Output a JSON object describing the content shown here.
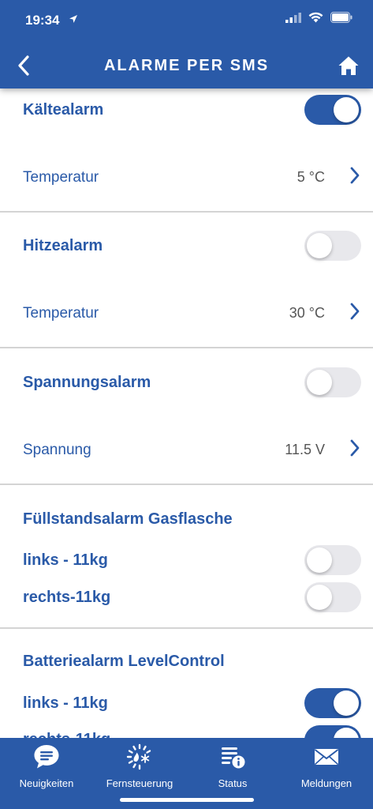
{
  "status": {
    "time": "19:34"
  },
  "header": {
    "title": "ALARME PER SMS"
  },
  "sections": {
    "kaelte": {
      "title": "Kältealarm",
      "toggle_on": true,
      "row_label": "Temperatur",
      "row_value": "5 °C"
    },
    "hitze": {
      "title": "Hitzealarm",
      "toggle_on": false,
      "row_label": "Temperatur",
      "row_value": "30 °C"
    },
    "spannung": {
      "title": "Spannungsalarm",
      "toggle_on": false,
      "row_label": "Spannung",
      "row_value": "11.5 V"
    },
    "fuellstand": {
      "title": "Füllstandsalarm Gasflasche",
      "left_label": "links - 11kg",
      "left_on": false,
      "right_label": "rechts-11kg",
      "right_on": false
    },
    "batterie": {
      "title": "Batteriealarm LevelControl",
      "left_label": "links - 11kg",
      "left_on": true,
      "right_label": "rechts-11kg",
      "right_on": true
    }
  },
  "tabs": [
    {
      "label": "Neuigkeiten",
      "icon": "chat-bubble-icon"
    },
    {
      "label": "Fernsteuerung",
      "icon": "remote-control-icon"
    },
    {
      "label": "Status",
      "icon": "status-info-icon"
    },
    {
      "label": "Meldungen",
      "icon": "envelope-icon"
    }
  ],
  "colors": {
    "primary": "#2a5aa8",
    "toggle_off": "#e8e8ec",
    "divider": "#d4d4d4"
  }
}
